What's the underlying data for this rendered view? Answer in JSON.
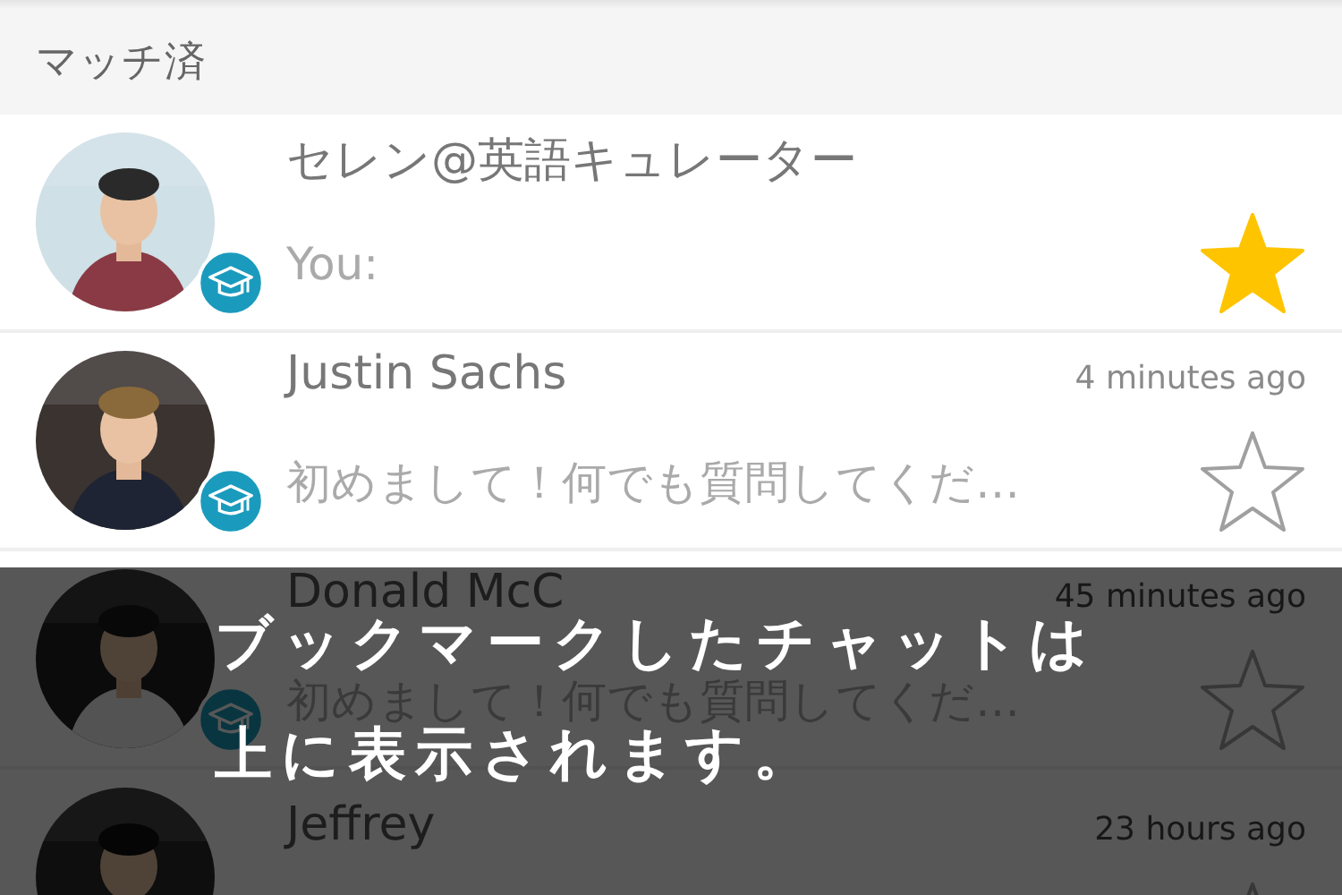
{
  "section": {
    "title": "マッチ済"
  },
  "chats": [
    {
      "name": "セレン@英語キュレーター",
      "message": "You:",
      "starred": true,
      "badge": true
    },
    {
      "name": "Justin Sachs",
      "time": "4 minutes ago",
      "message": "初めまして！何でも質問してくだ…",
      "starred": false,
      "badge": true
    },
    {
      "name": "Donald McC",
      "time": "45 minutes ago",
      "message": "初めまして！何でも質問してくだ…",
      "starred": false,
      "badge": true
    },
    {
      "name": "Jeffrey",
      "time": "23 hours ago",
      "starred": false
    }
  ],
  "overlay": {
    "lines": [
      "ブックマークしたチャットは",
      "上に表示されます。"
    ]
  }
}
